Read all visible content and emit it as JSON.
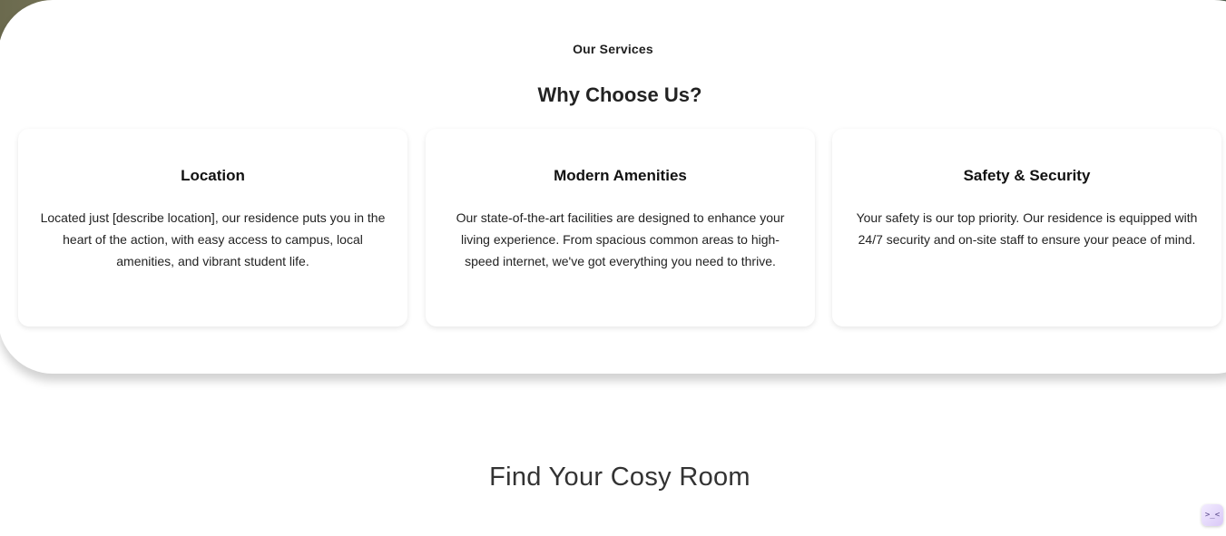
{
  "services": {
    "kicker": "Our Services",
    "title": "Why Choose Us?",
    "cards": [
      {
        "title": "Location",
        "text": "Located just [describe location], our residence puts you in the heart of the action, with easy access to campus, local amenities, and vibrant student life."
      },
      {
        "title": "Modern Amenities",
        "text": "Our state-of-the-art facilities are designed to enhance your living experience. From spacious common areas to high-speed internet, we've got everything you need to thrive."
      },
      {
        "title": "Safety & Security",
        "text": "Your safety is our top priority. Our residence is equipped with 24/7 security and on-site staff to ensure your peace of mind."
      }
    ]
  },
  "rooms": {
    "title": "Find Your Cosy Room"
  },
  "chat_widget": {
    "icon": "chat-icon",
    "glyph": ">_<"
  }
}
